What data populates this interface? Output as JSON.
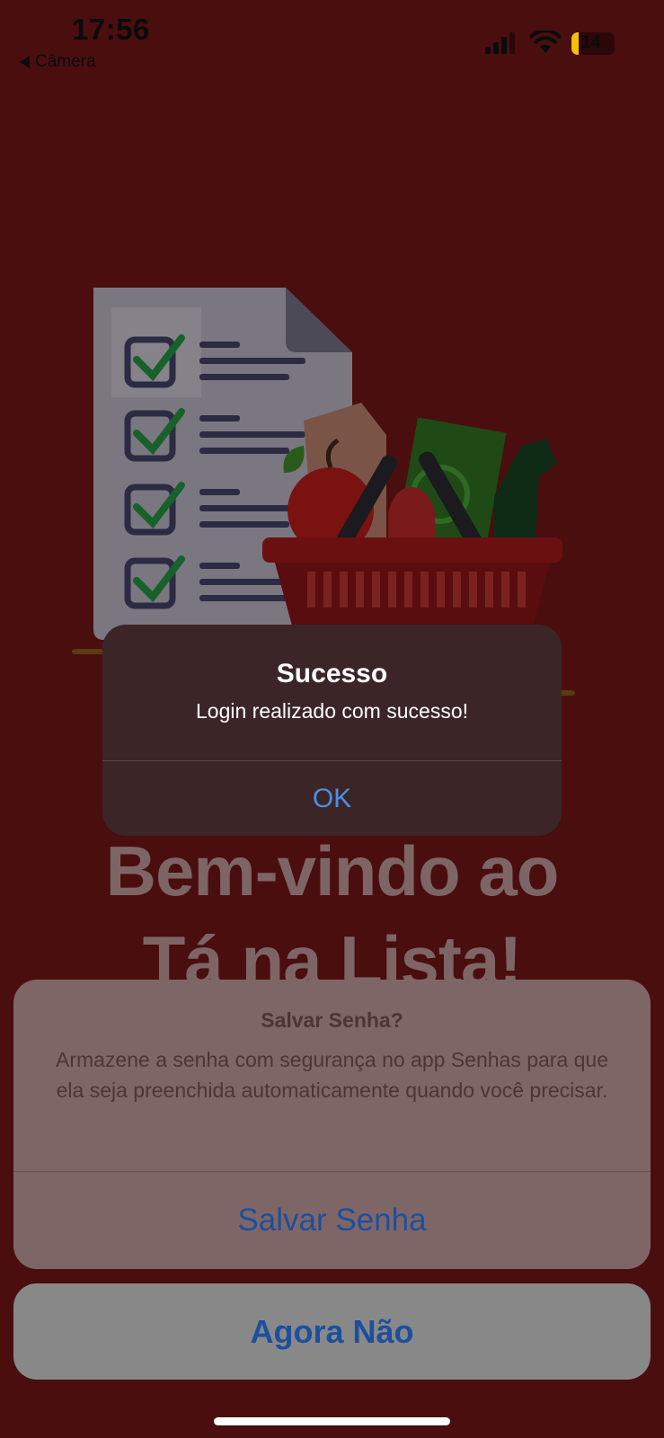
{
  "status_bar": {
    "time": "17:56",
    "back_label": "Câmera",
    "battery_level": "14",
    "icons": [
      "signal-icon",
      "wifi-icon",
      "battery-icon",
      "back-arrow-icon"
    ]
  },
  "illustration": {
    "icon": "shopping-checklist-illustration"
  },
  "welcome": {
    "line1": "Bem-vindo ao",
    "line2": "Tá na Lista!"
  },
  "alert": {
    "title": "Sucesso",
    "message": "Login realizado com sucesso!",
    "ok_label": "OK"
  },
  "password_sheet": {
    "title": "Salvar Senha?",
    "message": "Armazene a senha com segurança no app Senhas para que ela seja preenchida automaticamente quando você precisar.",
    "save_label": "Salvar Senha",
    "cancel_label": "Agora Não"
  },
  "colors": {
    "background": "#4a0e0f",
    "alert_background": "#3c2527",
    "link_blue": "#4a8fe8",
    "sheet_action_blue": "#1c4f9e"
  }
}
